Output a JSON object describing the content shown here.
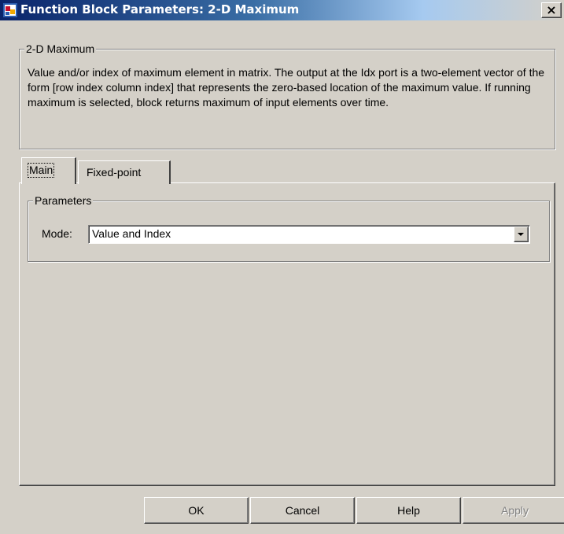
{
  "window": {
    "title": "Function Block Parameters: 2-D Maximum",
    "close_glyph": "×",
    "icon": "simulink-block-icon"
  },
  "description_group": {
    "legend": "2-D Maximum",
    "text": "Value and/or index of maximum element in matrix. The output at the Idx port is a two-element vector of the form [row index column index] that represents the zero-based location of the maximum value. If running maximum is selected, block returns maximum of input elements over time."
  },
  "tabs": [
    {
      "label": "Main",
      "selected": true
    },
    {
      "label": "Fixed-point",
      "selected": false
    }
  ],
  "parameters": {
    "legend": "Parameters",
    "mode_label": "Mode:",
    "mode_value": "Value and Index"
  },
  "buttons": {
    "ok": "OK",
    "cancel": "Cancel",
    "help": "Help",
    "apply": "Apply",
    "apply_enabled": false
  },
  "colors": {
    "face": "#d4d0c8",
    "titlebar_start": "#0a246a",
    "titlebar_end": "#a6caf0"
  }
}
